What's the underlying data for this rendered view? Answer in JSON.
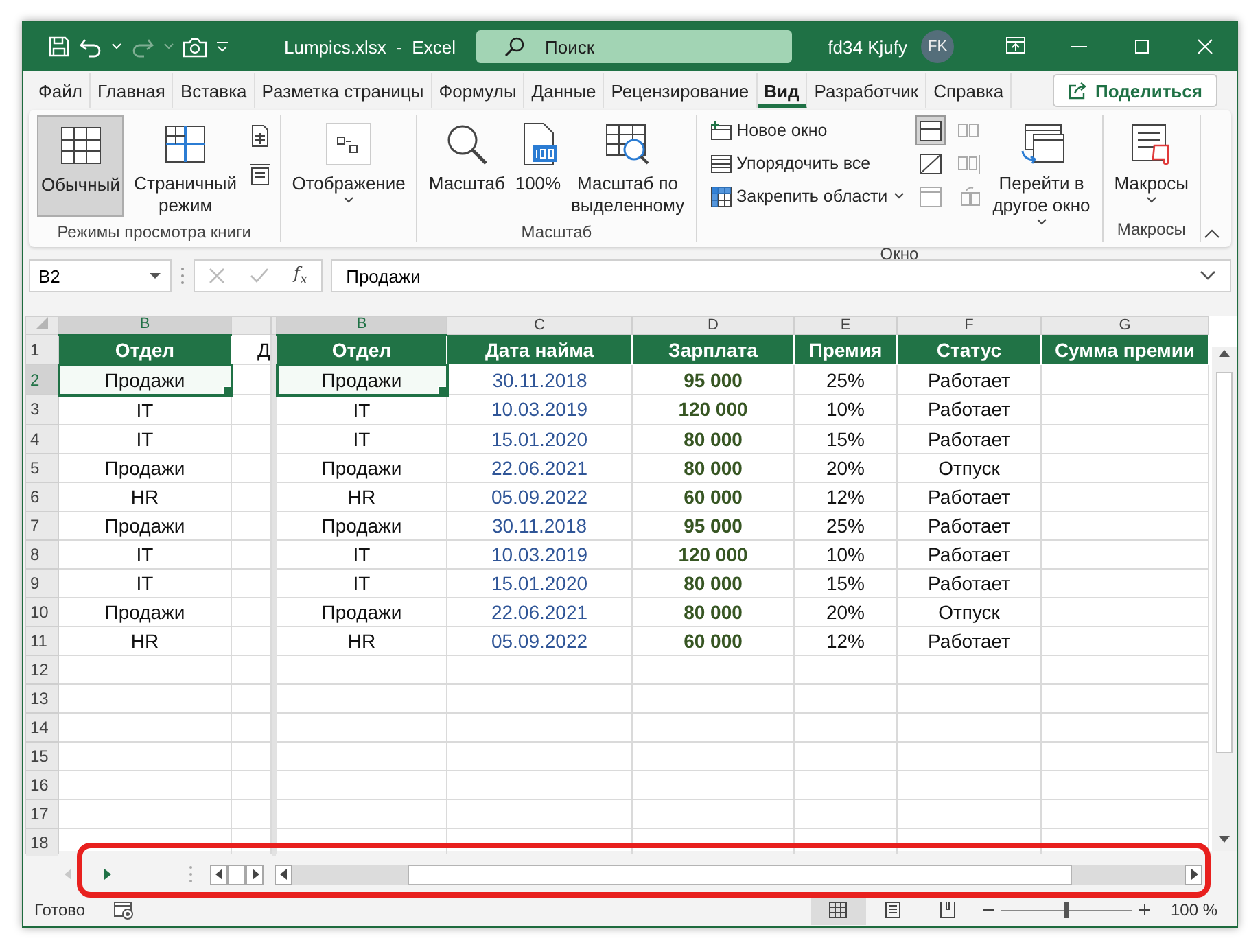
{
  "title_bar": {
    "title": "Lumpics.xlsx  -  Excel",
    "search": {
      "placeholder": "Поиск"
    },
    "user": {
      "name": "fd34 Kjufy",
      "initials": "FK"
    }
  },
  "tabs": [
    {
      "label": "Файл",
      "selected": false
    },
    {
      "label": "Главная",
      "selected": false
    },
    {
      "label": "Вставка",
      "selected": false
    },
    {
      "label": "Разметка страницы",
      "selected": false
    },
    {
      "label": "Формулы",
      "selected": false
    },
    {
      "label": "Данные",
      "selected": false
    },
    {
      "label": "Рецензирование",
      "selected": false
    },
    {
      "label": "Вид",
      "selected": true
    },
    {
      "label": "Разработчик",
      "selected": false
    },
    {
      "label": "Справка",
      "selected": false
    }
  ],
  "share_button": "Поделиться",
  "ribbon": [
    {
      "label": "Режимы просмотра книги",
      "items": [
        {
          "kind": "large",
          "label": "Обычный",
          "selected": true
        },
        {
          "kind": "large",
          "label": "Страничный режим",
          "selected": false
        },
        {
          "kind": "icon_column"
        }
      ]
    },
    {
      "items": [
        {
          "kind": "menu",
          "label": "Отображение",
          "selected": false
        }
      ]
    },
    {
      "label": "Масштаб",
      "items": [
        {
          "kind": "large",
          "label": "Масштаб",
          "selected": false
        },
        {
          "kind": "large",
          "label": "100%",
          "selected": false
        },
        {
          "kind": "large",
          "label": "Масштаб по выделенному",
          "selected": false
        }
      ]
    },
    {
      "label": "Окно",
      "items": [
        {
          "kind": "small_list",
          "entries": [
            {
              "label": "Новое окно"
            },
            {
              "label": "Упорядочить все"
            },
            {
              "label": "Закрепить области",
              "dropdown": true
            }
          ]
        },
        {
          "kind": "toggle_column",
          "toggles": [
            {
              "selected": true
            },
            {
              "selected": false
            },
            {
              "selected": false
            }
          ]
        },
        {
          "kind": "disabled_column"
        },
        {
          "kind": "large",
          "label": "Перейти в другое окно",
          "selected": false,
          "dropdown": true
        }
      ]
    },
    {
      "label": "Макросы",
      "items": [
        {
          "kind": "menu",
          "label": "Макросы",
          "selected": false
        }
      ]
    }
  ],
  "formula_bar": {
    "name_box": "B2",
    "function_label": "f$_{x}$",
    "formula": "Продажи"
  },
  "sheet": {
    "left_pane": {
      "columns": [
        {
          "label": "B",
          "selected": true
        }
      ],
      "headers": [
        "Отдел",
        "Д"
      ],
      "rows": [
        {
          "dept": "Продажи",
          "selected": true
        },
        {
          "dept": "IT",
          "selected": false
        },
        {
          "dept": "IT",
          "selected": false
        },
        {
          "dept": "Продажи",
          "selected": false
        },
        {
          "dept": "HR",
          "selected": false
        },
        {
          "dept": "Продажи",
          "selected": false
        },
        {
          "dept": "IT",
          "selected": false
        },
        {
          "dept": "IT",
          "selected": false
        },
        {
          "dept": "Продажи",
          "selected": false
        },
        {
          "dept": "HR",
          "selected": false
        }
      ]
    },
    "right_pane": {
      "columns": [
        {
          "label": "B",
          "selected": true
        },
        {
          "label": "C",
          "selected": false
        },
        {
          "label": "D",
          "selected": false
        },
        {
          "label": "E",
          "selected": false
        },
        {
          "label": "F",
          "selected": false
        },
        {
          "label": "G",
          "selected": false
        }
      ],
      "headers": [
        "Отдел",
        "Дата найма",
        "Зарплата",
        "Премия",
        "Статус",
        "Сумма премии"
      ],
      "rows": [
        {
          "dept": "Продажи",
          "date": "30.11.2018",
          "salary": "95 000",
          "bonus": "25%",
          "status": "Работает",
          "selected": true
        },
        {
          "dept": "IT",
          "date": "10.03.2019",
          "salary": "120 000",
          "bonus": "10%",
          "status": "Работает",
          "selected": false
        },
        {
          "dept": "IT",
          "date": "15.01.2020",
          "salary": "80 000",
          "bonus": "15%",
          "status": "Работает",
          "selected": false
        },
        {
          "dept": "Продажи",
          "date": "22.06.2021",
          "salary": "80 000",
          "bonus": "20%",
          "status": "Отпуск",
          "selected": false
        },
        {
          "dept": "HR",
          "date": "05.09.2022",
          "salary": "60 000",
          "bonus": "12%",
          "status": "Работает",
          "selected": false
        },
        {
          "dept": "Продажи",
          "date": "30.11.2018",
          "salary": "95 000",
          "bonus": "25%",
          "status": "Работает",
          "selected": false
        },
        {
          "dept": "IT",
          "date": "10.03.2019",
          "salary": "120 000",
          "bonus": "10%",
          "status": "Работает",
          "selected": false
        },
        {
          "dept": "IT",
          "date": "15.01.2020",
          "salary": "80 000",
          "bonus": "15%",
          "status": "Работает",
          "selected": false
        },
        {
          "dept": "Продажи",
          "date": "22.06.2021",
          "salary": "80 000",
          "bonus": "20%",
          "status": "Отпуск",
          "selected": false
        },
        {
          "dept": "HR",
          "date": "05.09.2022",
          "salary": "60 000",
          "bonus": "12%",
          "status": "Работает",
          "selected": false
        }
      ]
    },
    "row_numbers": [
      {
        "label": "1",
        "selected": false
      },
      {
        "label": "2",
        "selected": true
      },
      {
        "label": "3",
        "selected": false
      },
      {
        "label": "4",
        "selected": false
      },
      {
        "label": "5",
        "selected": false
      },
      {
        "label": "6",
        "selected": false
      },
      {
        "label": "7",
        "selected": false
      },
      {
        "label": "8",
        "selected": false
      },
      {
        "label": "9",
        "selected": false
      },
      {
        "label": "10",
        "selected": false
      },
      {
        "label": "11",
        "selected": false
      },
      {
        "label": "12",
        "selected": false
      },
      {
        "label": "13",
        "selected": false
      },
      {
        "label": "14",
        "selected": false
      },
      {
        "label": "15",
        "selected": false
      },
      {
        "label": "16",
        "selected": false
      },
      {
        "label": "17",
        "selected": false
      },
      {
        "label": "18",
        "selected": false
      }
    ]
  },
  "status_bar": {
    "status": "Готово",
    "views": [
      {
        "selected": true
      },
      {
        "selected": false
      },
      {
        "selected": false
      }
    ],
    "zoom": {
      "level": 0.5,
      "reading": "100 %"
    }
  }
}
